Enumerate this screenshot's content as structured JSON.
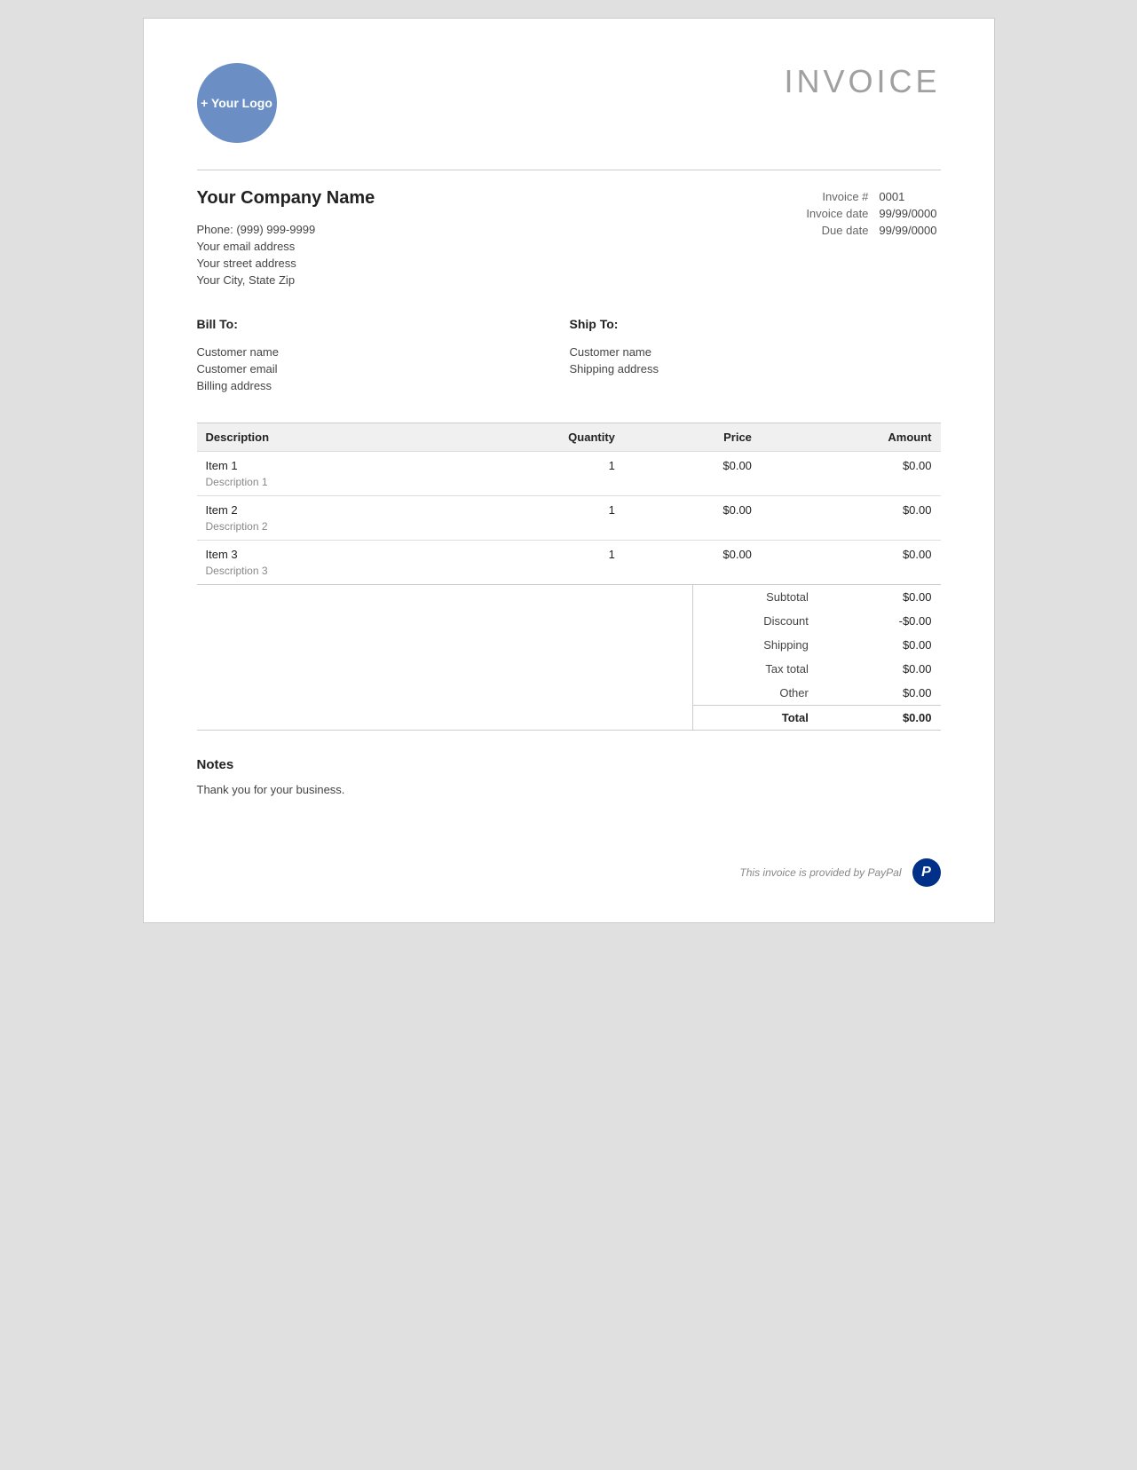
{
  "invoice": {
    "title": "INVOICE",
    "logo": {
      "text": "+ Your\nLogo"
    },
    "company": {
      "name": "Your Company Name",
      "phone": "Phone: (999) 999-9999",
      "email": "Your email address",
      "street": "Your street address",
      "city": "Your City, State Zip"
    },
    "meta": {
      "invoice_label": "Invoice #",
      "invoice_number": "0001",
      "date_label": "Invoice date",
      "invoice_date": "99/99/0000",
      "due_label": "Due date",
      "due_date": "99/99/0000"
    },
    "bill_to": {
      "heading": "Bill To:",
      "customer_name": "Customer name",
      "customer_email": "Customer email",
      "billing_address": "Billing address"
    },
    "ship_to": {
      "heading": "Ship To:",
      "customer_name": "Customer name",
      "shipping_address": "Shipping address"
    },
    "table": {
      "headers": {
        "description": "Description",
        "quantity": "Quantity",
        "price": "Price",
        "amount": "Amount"
      },
      "items": [
        {
          "name": "Item 1",
          "description": "Description 1",
          "quantity": "1",
          "price": "$0.00",
          "amount": "$0.00"
        },
        {
          "name": "Item 2",
          "description": "Description 2",
          "quantity": "1",
          "price": "$0.00",
          "amount": "$0.00"
        },
        {
          "name": "Item 3",
          "description": "Description 3",
          "quantity": "1",
          "price": "$0.00",
          "amount": "$0.00"
        }
      ]
    },
    "totals": {
      "subtotal_label": "Subtotal",
      "subtotal_value": "$0.00",
      "discount_label": "Discount",
      "discount_value": "-$0.00",
      "shipping_label": "Shipping",
      "shipping_value": "$0.00",
      "tax_label": "Tax total",
      "tax_value": "$0.00",
      "other_label": "Other",
      "other_value": "$0.00",
      "total_label": "Total",
      "total_value": "$0.00"
    },
    "notes": {
      "heading": "Notes",
      "text": "Thank you for your business."
    },
    "footer": {
      "text": "This invoice is provided by PayPal",
      "paypal_symbol": "P"
    }
  }
}
